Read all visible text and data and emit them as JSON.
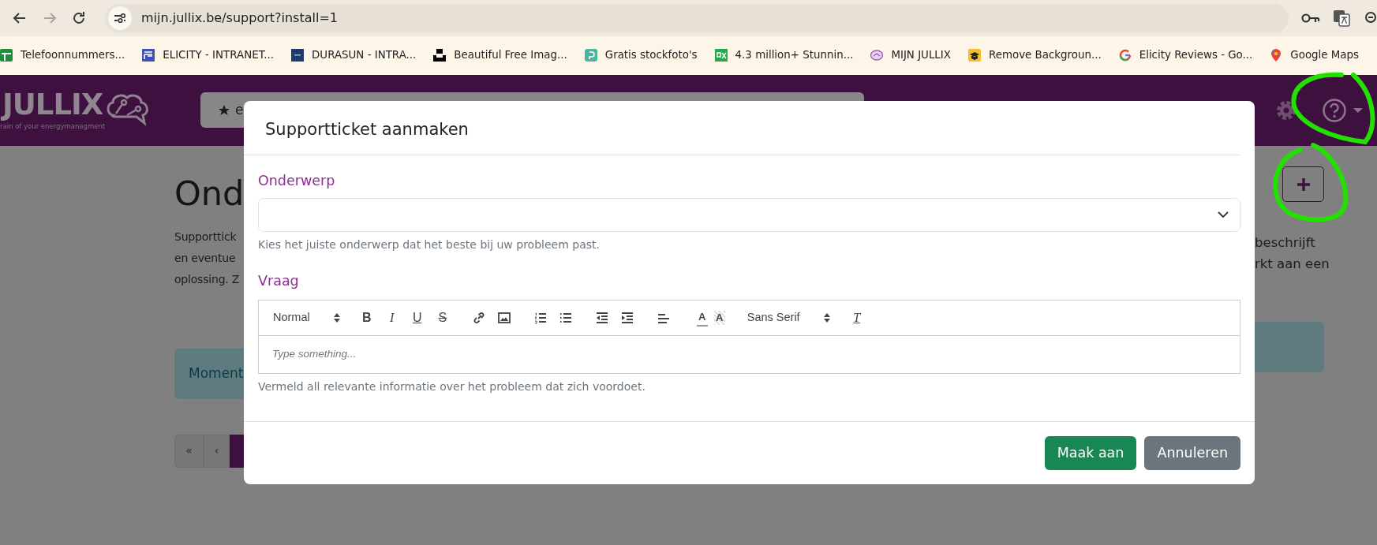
{
  "browser": {
    "nav_buttons": [
      {
        "kind": "back",
        "disabled": false
      },
      {
        "kind": "forward",
        "disabled": true
      },
      {
        "kind": "reload",
        "disabled": false
      }
    ],
    "address": "mijn.jullix.be/support?install=1",
    "bookmarks": [
      {
        "label": "Telefoonnummers..."
      },
      {
        "label": "ELICITY - INTRANET..."
      },
      {
        "label": "DURASUN - INTRA..."
      },
      {
        "label": "Beautiful Free Imag..."
      },
      {
        "label": "Gratis stockfoto's"
      },
      {
        "label": "4.3 million+ Stunnin..."
      },
      {
        "label": "MIJN JULLIX"
      },
      {
        "label": "Remove Backgroun..."
      },
      {
        "label": "Elicity Reviews - Go..."
      },
      {
        "label": "Google Maps"
      }
    ]
  },
  "navbar": {
    "logo": "JULLIX",
    "tagline": "rain of your energymanagment",
    "search_text": "e"
  },
  "page": {
    "title": "Ond",
    "paragraph_left": [
      "Supporttick",
      "en eventue",
      "oplossing. Z"
    ],
    "paragraph_right": [
      "beschrijft",
      "rkt aan een"
    ],
    "alert_left": "Moment",
    "pagination": [
      {
        "label": "«",
        "selected": false
      },
      {
        "label": "‹",
        "selected": false
      },
      {
        "selected": true
      }
    ]
  },
  "modal": {
    "title": "Supportticket aanmaken",
    "fields": [
      {
        "kind": "select",
        "label": "Onderwerp",
        "help": "Kies het juiste onderwerp dat het beste bij uw probleem past."
      },
      {
        "kind": "editor",
        "label": "Vraag",
        "placeholder": "Type something...",
        "help": "Vermeld all relevante informatie over het probleem dat zich voordoet.",
        "toolbar": [
          {
            "kind": "picker",
            "label": "Normal"
          },
          {
            "kind": "glyph",
            "label": "B"
          },
          {
            "kind": "glyph",
            "label": "I"
          },
          {
            "kind": "glyph",
            "label": "U"
          },
          {
            "kind": "glyph",
            "label": "S"
          },
          {
            "kind": "icon"
          },
          {
            "kind": "icon"
          },
          {
            "kind": "icon"
          },
          {
            "kind": "icon"
          },
          {
            "kind": "icon"
          },
          {
            "kind": "icon"
          },
          {
            "kind": "icon"
          },
          {
            "kind": "glyph",
            "label": "A"
          },
          {
            "kind": "glyph",
            "label": "A"
          },
          {
            "kind": "picker",
            "label": "Sans Serif"
          },
          {
            "kind": "glyph",
            "label": "T"
          }
        ]
      }
    ],
    "buttons": [
      {
        "label": "Maak aan"
      },
      {
        "label": "Annuleren"
      }
    ]
  }
}
